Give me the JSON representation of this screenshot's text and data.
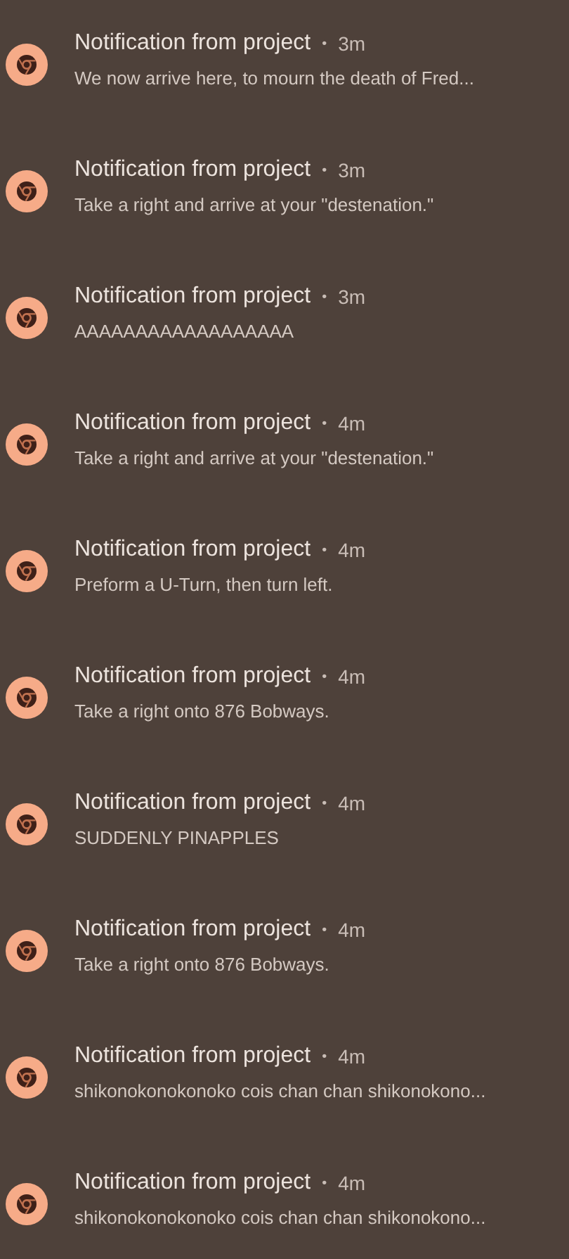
{
  "notifications": [
    {
      "title": "Notification from project",
      "separator": "•",
      "time": "3m",
      "body": "We now arrive here, to mourn the death of Fred..."
    },
    {
      "title": "Notification from project",
      "separator": "•",
      "time": "3m",
      "body": "Take a right and arrive at your \"destenation.\""
    },
    {
      "title": "Notification from project",
      "separator": "•",
      "time": "3m",
      "body": "AAAAAAAAAAAAAAAAAA"
    },
    {
      "title": "Notification from project",
      "separator": "•",
      "time": "4m",
      "body": "Take a right and arrive at your \"destenation.\""
    },
    {
      "title": "Notification from project",
      "separator": "•",
      "time": "4m",
      "body": "Preform a U-Turn, then turn left."
    },
    {
      "title": "Notification from project",
      "separator": "•",
      "time": "4m",
      "body": "Take a right onto 876 Bobways."
    },
    {
      "title": "Notification from project",
      "separator": "•",
      "time": "4m",
      "body": "SUDDENLY PINAPPLES"
    },
    {
      "title": "Notification from project",
      "separator": "•",
      "time": "4m",
      "body": "Take a right onto 876 Bobways."
    },
    {
      "title": "Notification from project",
      "separator": "•",
      "time": "4m",
      "body": "shikonokonokonoko cois chan chan shikonokono..."
    },
    {
      "title": "Notification from project",
      "separator": "•",
      "time": "4m",
      "body": "shikonokonokonoko cois chan chan shikonokono..."
    }
  ]
}
